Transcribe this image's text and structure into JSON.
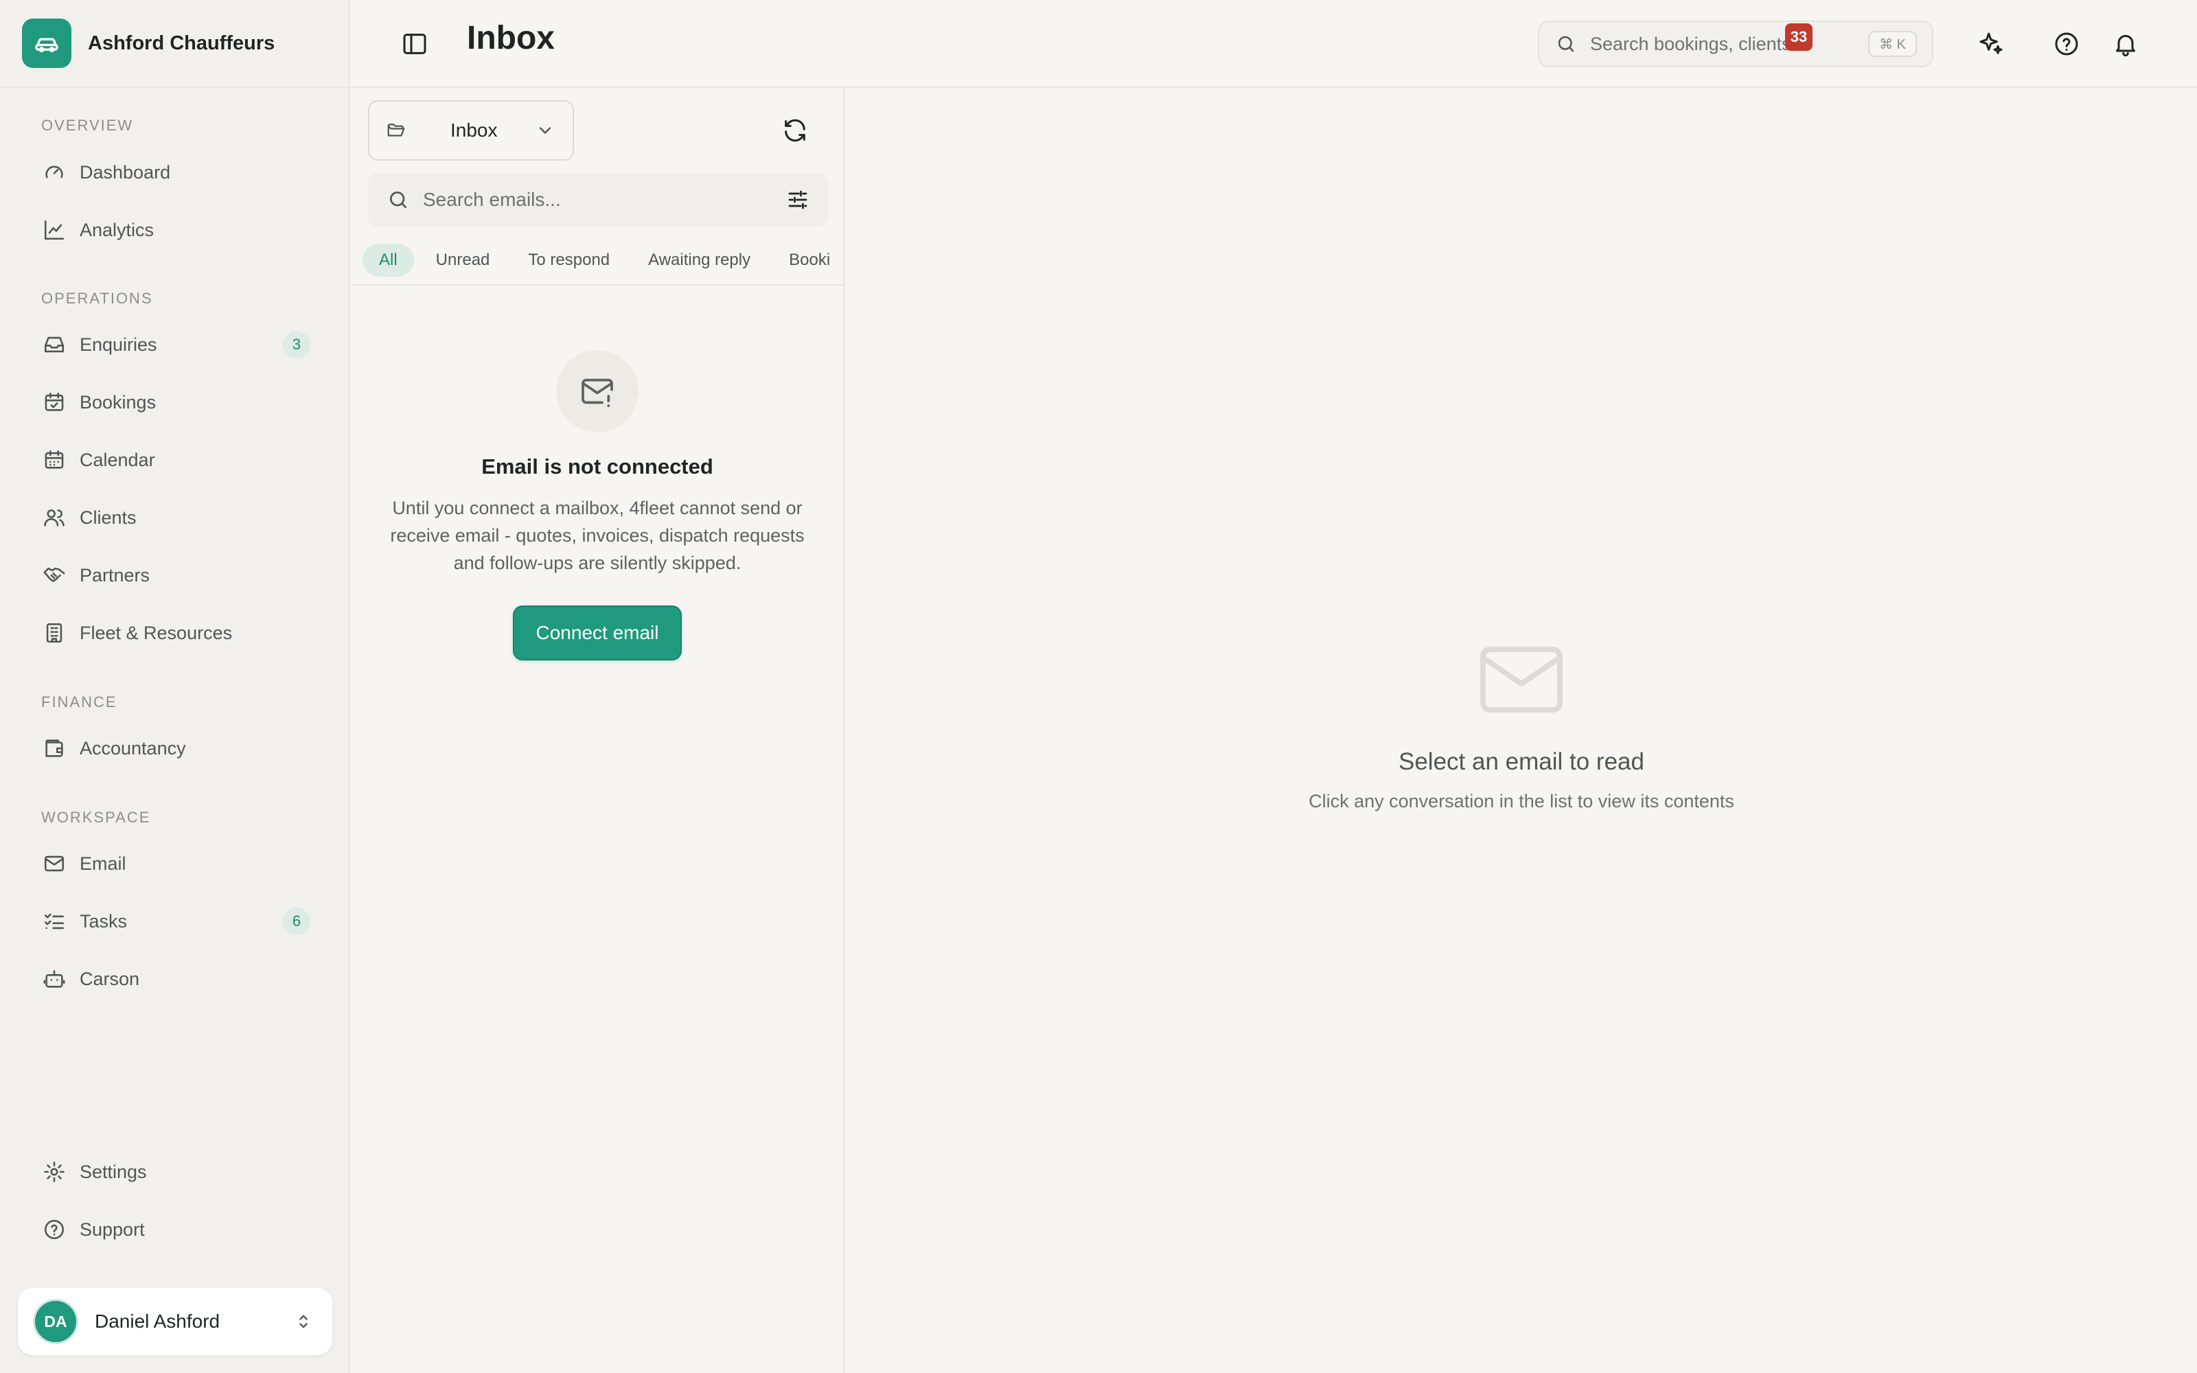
{
  "brand": {
    "name": "Ashford Chauffeurs",
    "logo_icon": "car-icon",
    "accent": "#1f9a7e"
  },
  "sidebar": {
    "sections": {
      "overview": "OVERVIEW",
      "operations": "OPERATIONS",
      "finance": "FINANCE",
      "workspace": "WORKSPACE"
    },
    "items": {
      "dashboard": {
        "label": "Dashboard",
        "icon": "gauge-icon"
      },
      "analytics": {
        "label": "Analytics",
        "icon": "line-chart-icon"
      },
      "enquiries": {
        "label": "Enquiries",
        "icon": "inbox-icon",
        "badge": "3"
      },
      "bookings": {
        "label": "Bookings",
        "icon": "calendar-check-icon"
      },
      "calendar": {
        "label": "Calendar",
        "icon": "calendar-icon"
      },
      "clients": {
        "label": "Clients",
        "icon": "users-icon"
      },
      "partners": {
        "label": "Partners",
        "icon": "handshake-icon"
      },
      "fleet": {
        "label": "Fleet & Resources",
        "icon": "building-icon"
      },
      "accountancy": {
        "label": "Accountancy",
        "icon": "wallet-icon"
      },
      "email": {
        "label": "Email",
        "icon": "mail-icon"
      },
      "tasks": {
        "label": "Tasks",
        "icon": "list-checks-icon",
        "badge": "6"
      },
      "carson": {
        "label": "Carson",
        "icon": "bot-icon"
      },
      "settings": {
        "label": "Settings",
        "icon": "gear-icon"
      },
      "support": {
        "label": "Support",
        "icon": "help-circle-icon"
      }
    },
    "user": {
      "initials": "DA",
      "name": "Daniel Ashford"
    }
  },
  "header": {
    "title": "Inbox",
    "search_placeholder": "Search bookings, clients...",
    "search_shortcut": "⌘ K",
    "notification_count": "33"
  },
  "email_list": {
    "folder": "Inbox",
    "search_placeholder": "Search emails...",
    "tabs": [
      "All",
      "Unread",
      "To respond",
      "Awaiting reply",
      "Booki"
    ],
    "active_tab": "All",
    "empty": {
      "title": "Email is not connected",
      "description": "Until you connect a mailbox, 4fleet cannot send or receive email - quotes, invoices, dispatch requests and follow-ups are silently skipped.",
      "button": "Connect email"
    }
  },
  "reader": {
    "title": "Select an email to read",
    "subtitle": "Click any conversation in the list to view its contents"
  },
  "colors": {
    "accent": "#1f9a7e",
    "badge_bg": "#dcebe4",
    "alert": "#c0392b"
  }
}
